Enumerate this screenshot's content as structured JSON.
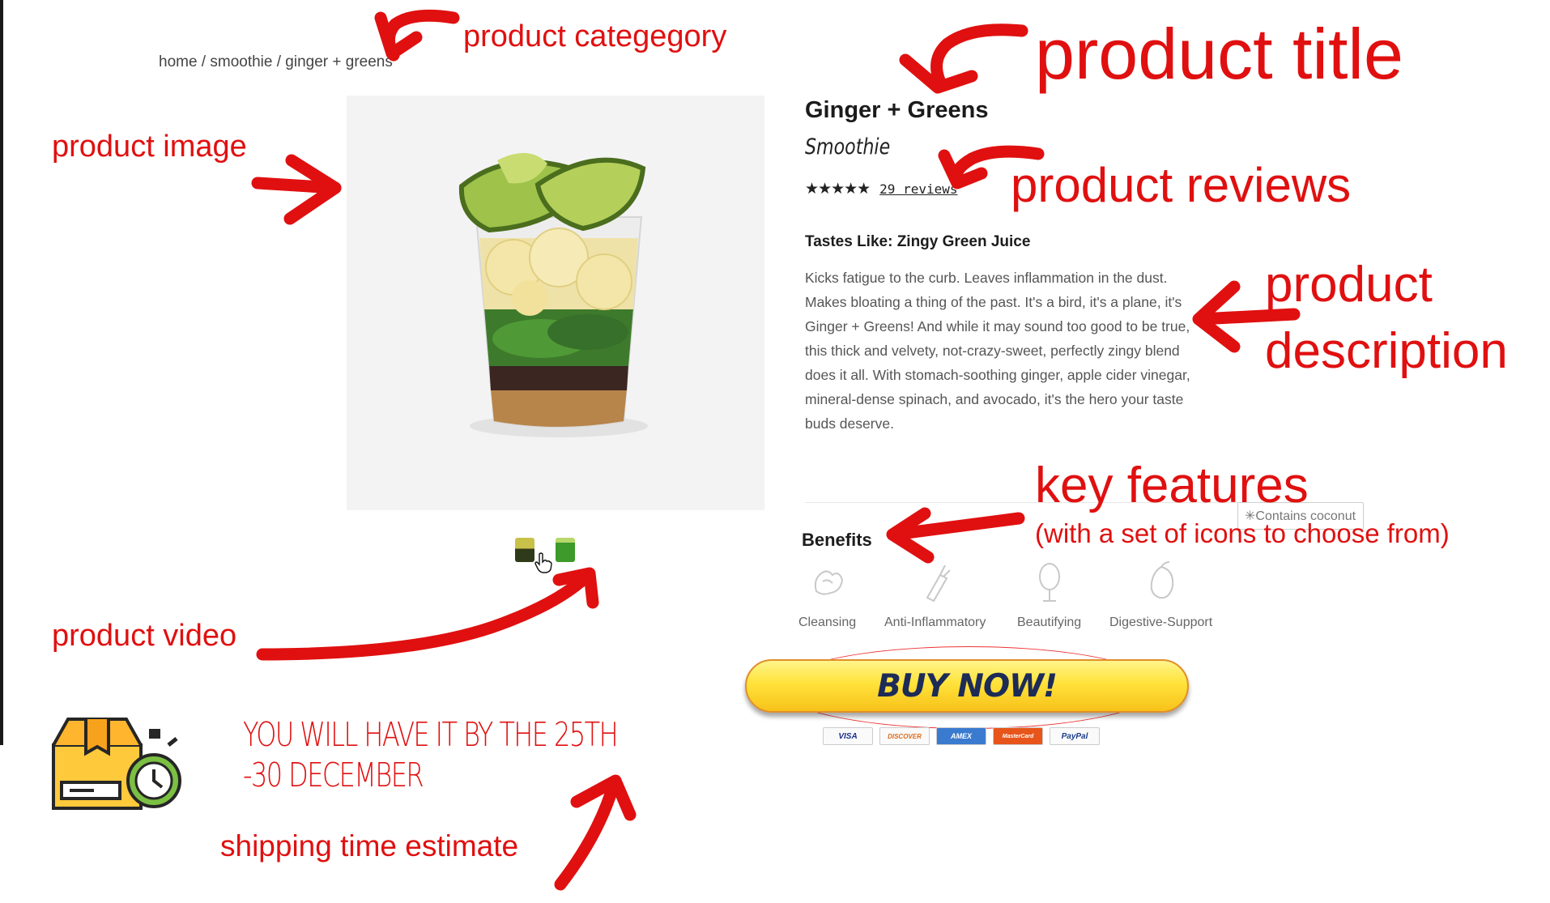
{
  "breadcrumb": "home / smoothie / ginger + greens",
  "product": {
    "title": "Ginger + Greens",
    "subtitle": "Smoothie",
    "stars": "★★★★★",
    "reviews_label": "29 reviews",
    "tastes_like": "Tastes Like: Zingy Green Juice",
    "description": "Kicks fatigue to the curb. Leaves inflammation in the dust. Makes bloating a thing of the past. It's a bird, it's a plane, it's Ginger + Greens! And while it may sound too good to be true, this thick and velvety, not-crazy-sweet, perfectly zingy blend does it all. With stomach-soothing ginger, apple cider vinegar, mineral-dense spinach, and avocado, it's the hero your taste buds deserve.",
    "contains_note": "✳Contains coconut"
  },
  "benefits": {
    "title": "Benefits",
    "items": [
      {
        "label": "Cleansing",
        "icon": "cleansing-icon"
      },
      {
        "label": "Anti-Inflammatory",
        "icon": "anti-inflammatory-icon"
      },
      {
        "label": "Beautifying",
        "icon": "beautifying-icon"
      },
      {
        "label": "Digestive-Support",
        "icon": "digestive-support-icon"
      }
    ]
  },
  "buy_button": "BUY NOW!",
  "payment_cards": [
    "VISA",
    "DISCOVER",
    "AMEX",
    "MasterCard",
    "PayPal"
  ],
  "annotations": {
    "category": "product categegory",
    "title": "product title",
    "image": "product image",
    "reviews": "product reviews",
    "description_line1": "product",
    "description_line2": "description",
    "features": "key features",
    "features_sub": "(with a set of icons to choose from)",
    "video": "product video",
    "shipping_time": "YOU WILL HAVE IT BY THE 25TH\n-30 DECEMBER",
    "shipping_estimate": "shipping time estimate"
  },
  "colors": {
    "annotation_red": "#e01010",
    "button_yellow": "#ffe23a",
    "button_text": "#1d2b57",
    "shipping_box": "#ffc93c"
  }
}
